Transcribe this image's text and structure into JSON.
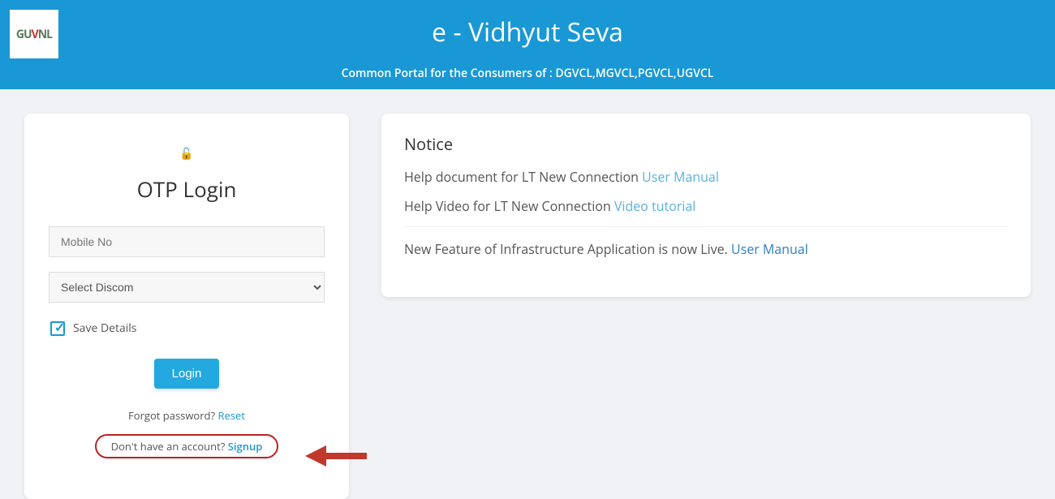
{
  "header": {
    "logo_text_left": "GU",
    "logo_text_mid": "V",
    "logo_text_right": "NL",
    "title": "e - Vidhyut Seva",
    "subtitle": "Common Portal for the Consumers of : DGVCL,MGVCL,PGVCL,UGVCL"
  },
  "login": {
    "title": "OTP Login",
    "mobile_placeholder": "Mobile No",
    "discom_placeholder": "Select Discom",
    "save_label": "Save Details",
    "login_button": "Login",
    "forgot_text": "Forgot password? ",
    "forgot_link": "Reset",
    "signup_text": "Don't have an account? ",
    "signup_link": "Signup"
  },
  "notice": {
    "title": "Notice",
    "line1_text": "Help document for LT New Connection ",
    "line1_link": "User Manual",
    "line2_text": "Help Video for LT New Connection ",
    "line2_link": "Video tutorial",
    "line3_text": "New Feature of Infrastructure Application is now Live. ",
    "line3_link": "User Manual"
  }
}
